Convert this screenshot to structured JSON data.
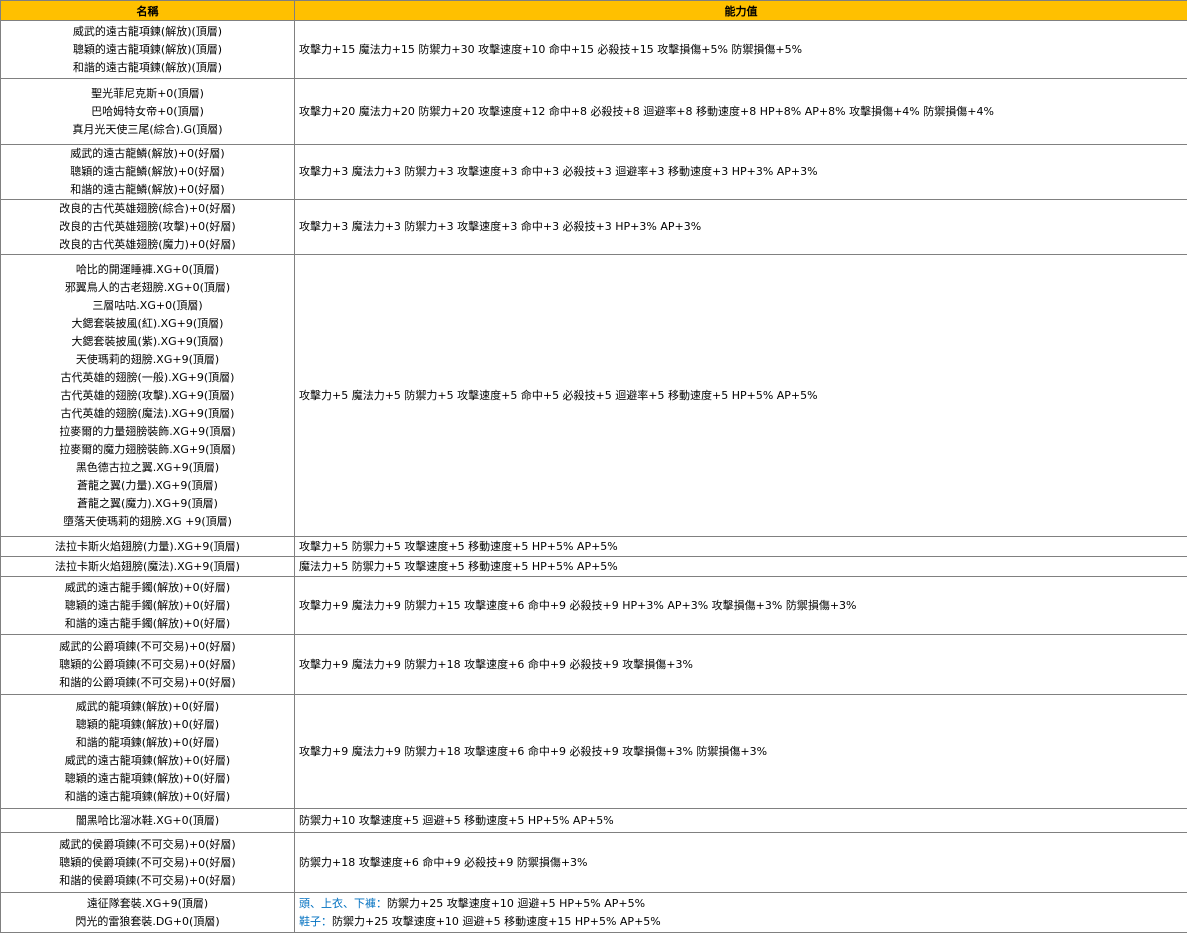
{
  "header": {
    "name": "名稱",
    "value": "能力值"
  },
  "rows": [
    {
      "names": [
        "威武的遠古龍項鍊(解放)(頂層)",
        "聰穎的遠古龍項鍊(解放)(頂層)",
        "和諧的遠古龍項鍊(解放)(頂層)"
      ],
      "value": "攻擊力+15 魔法力+15 防禦力+30 攻擊速度+10 命中+15 必殺技+15 攻擊損傷+5% 防禦損傷+5%"
    },
    {
      "names": [
        "聖光菲尼克斯+0(頂層)",
        "巴哈姆特女帝+0(頂層)",
        "真月光天使三尾(綜合).G(頂層)"
      ],
      "value": "攻擊力+20 魔法力+20 防禦力+20 攻擊速度+12 命中+8 必殺技+8 迴避率+8 移動速度+8 HP+8% AP+8% 攻擊損傷+4% 防禦損傷+4%"
    },
    {
      "names": [
        "威武的遠古龍鱗(解放)+0(好層)",
        "聰穎的遠古龍鱗(解放)+0(好層)",
        "和諧的遠古龍鱗(解放)+0(好層)"
      ],
      "value": "攻擊力+3 魔法力+3 防禦力+3 攻擊速度+3 命中+3 必殺技+3 迴避率+3 移動速度+3  HP+3% AP+3%"
    },
    {
      "names": [
        "改良的古代英雄翅膀(綜合)+0(好層)",
        "改良的古代英雄翅膀(攻擊)+0(好層)",
        "改良的古代英雄翅膀(魔力)+0(好層)"
      ],
      "value": "攻擊力+3 魔法力+3 防禦力+3 攻擊速度+3 命中+3 必殺技+3 HP+3% AP+3%"
    },
    {
      "names": [
        "哈比的開運睡褲.XG+0(頂層)",
        "邪翼鳥人的古老翅膀.XG+0(頂層)",
        "三層咕咕.XG+0(頂層)",
        "大鍶套裝披風(紅).XG+9(頂層)",
        "大鍶套裝披風(紫).XG+9(頂層)",
        "天使瑪莉的翅膀.XG+9(頂層)",
        "古代英雄的翅膀(一般).XG+9(頂層)",
        "古代英雄的翅膀(攻擊).XG+9(頂層)",
        "古代英雄的翅膀(魔法).XG+9(頂層)",
        "拉麥爾的力量翅膀裝飾.XG+9(頂層)",
        "拉麥爾的魔力翅膀裝飾.XG+9(頂層)",
        "黑色德古拉之翼.XG+9(頂層)",
        "蒼龍之翼(力量).XG+9(頂層)",
        "蒼龍之翼(魔力).XG+9(頂層)",
        "墮落天使瑪莉的翅膀.XG +9(頂層)"
      ],
      "value": "攻擊力+5 魔法力+5 防禦力+5 攻擊速度+5 命中+5 必殺技+5 迴避率+5 移動速度+5  HP+5% AP+5%"
    },
    {
      "names": [
        "法拉卡斯火焰翅膀(力量).XG+9(頂層)"
      ],
      "value": "攻擊力+5 防禦力+5 攻擊速度+5 移動速度+5 HP+5% AP+5%"
    },
    {
      "names": [
        "法拉卡斯火焰翅膀(魔法).XG+9(頂層)"
      ],
      "value": "魔法力+5 防禦力+5 攻擊速度+5 移動速度+5 HP+5% AP+5%"
    },
    {
      "names": [
        "威武的遠古龍手鐲(解放)+0(好層)",
        "聰穎的遠古龍手鐲(解放)+0(好層)",
        "和諧的遠古龍手鐲(解放)+0(好層)"
      ],
      "value": "攻擊力+9 魔法力+9 防禦力+15 攻擊速度+6 命中+9 必殺技+9  HP+3% AP+3% 攻擊損傷+3% 防禦損傷+3%"
    },
    {
      "names": [
        "威武的公爵項鍊(不可交易)+0(好層)",
        "聰穎的公爵項鍊(不可交易)+0(好層)",
        "和諧的公爵項鍊(不可交易)+0(好層)"
      ],
      "value": "攻擊力+9 魔法力+9 防禦力+18 攻擊速度+6 命中+9 必殺技+9 攻擊損傷+3%"
    },
    {
      "names": [
        "威武的龍項鍊(解放)+0(好層)",
        "聰穎的龍項鍊(解放)+0(好層)",
        "和諧的龍項鍊(解放)+0(好層)",
        "威武的遠古龍項鍊(解放)+0(好層)",
        "聰穎的遠古龍項鍊(解放)+0(好層)",
        "和諧的遠古龍項鍊(解放)+0(好層)"
      ],
      "value": "攻擊力+9 魔法力+9 防禦力+18 攻擊速度+6 命中+9 必殺技+9 攻擊損傷+3% 防禦損傷+3%"
    },
    {
      "names": [
        "闇黑哈比溜冰鞋.XG+0(頂層)"
      ],
      "value": "防禦力+10 攻擊速度+5 迴避+5 移動速度+5 HP+5% AP+5%"
    },
    {
      "names": [
        "威武的侯爵項鍊(不可交易)+0(好層)",
        "聰穎的侯爵項鍊(不可交易)+0(好層)",
        "和諧的侯爵項鍊(不可交易)+0(好層)"
      ],
      "value": "防禦力+18 攻擊速度+6 命中+9 必殺技+9  防禦損傷+3%"
    }
  ],
  "last_row": {
    "names": [
      "遠征隊套裝.XG+9(頂層)",
      "閃光的雷狼套裝.DG+0(頂層)"
    ],
    "line1_label": "頭、上衣、下褲：",
    "line1_value": "防禦力+25 攻擊速度+10 迴避+5 HP+5% AP+5%",
    "line2_label": "鞋子：",
    "line2_value": "防禦力+25 攻擊速度+10 迴避+5 移動速度+15 HP+5% AP+5%"
  }
}
